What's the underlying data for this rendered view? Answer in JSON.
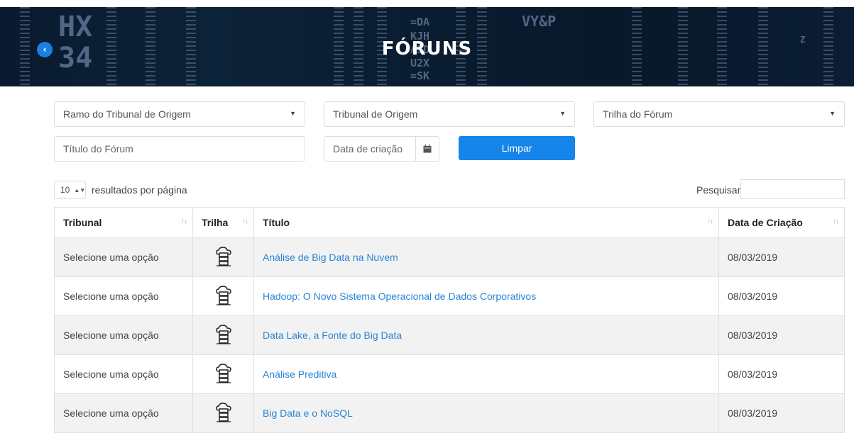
{
  "header": {
    "back_icon": "chevron-left-icon",
    "title": "FÓRUNS",
    "background_glyphs": [
      "HX",
      "34",
      "=DA",
      "KJH",
      "A3D",
      "U2X",
      "=SK",
      "VY&P",
      "Z"
    ]
  },
  "filters": {
    "ramo": "Ramo do Tribunal de Origem",
    "tribunal": "Tribunal de Origem",
    "trilha": "Trilha do Fórum",
    "titulo_placeholder": "Título do Fórum",
    "data_placeholder": "Data de criação",
    "calendar_icon": "calendar-icon",
    "limpar": "Limpar"
  },
  "table_controls": {
    "page_length": "10",
    "page_length_suffix": "resultados por página",
    "search_label": "Pesquisar",
    "search_value": ""
  },
  "table": {
    "headers": [
      "Tribunal",
      "Trilha",
      "Título",
      "Data de Criação"
    ],
    "rows": [
      {
        "tribunal": "Selecione uma opção",
        "trilha_icon": "cloud-server-icon",
        "titulo": "Análise de Big Data na Nuvem",
        "data": "08/03/2019"
      },
      {
        "tribunal": "Selecione uma opção",
        "trilha_icon": "cloud-server-icon",
        "titulo": "Hadoop: O Novo Sistema Operacional de Dados Corporativos",
        "data": "08/03/2019"
      },
      {
        "tribunal": "Selecione uma opção",
        "trilha_icon": "cloud-server-icon",
        "titulo": "Data Lake, a Fonte do Big Data",
        "data": "08/03/2019"
      },
      {
        "tribunal": "Selecione uma opção",
        "trilha_icon": "cloud-server-icon",
        "titulo": "Análise Preditiva",
        "data": "08/03/2019"
      },
      {
        "tribunal": "Selecione uma opção",
        "trilha_icon": "cloud-server-icon",
        "titulo": "Big Data e o NoSQL",
        "data": "08/03/2019"
      }
    ]
  },
  "colors": {
    "accent": "#1585ea",
    "link": "#2a84d6",
    "banner_bg": "#0a1a2e",
    "stripe": "#f2f2f2"
  }
}
